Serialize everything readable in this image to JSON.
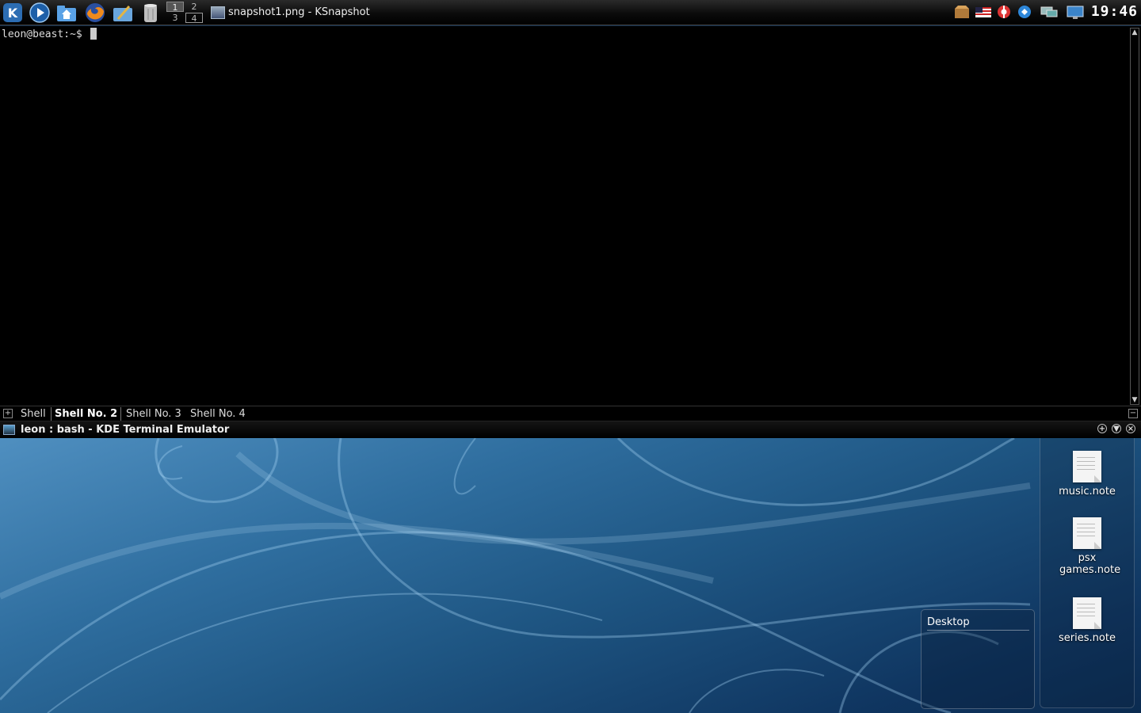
{
  "taskbar": {
    "launchers": [
      {
        "icon": "kde-menu-icon",
        "color": "#3b7bc2"
      },
      {
        "icon": "media-player-icon",
        "color": "#2d7fd0"
      },
      {
        "icon": "home-folder-icon",
        "color": "#4a90d9"
      },
      {
        "icon": "firefox-icon",
        "color": "#e86b1c"
      },
      {
        "icon": "text-editor-icon",
        "color": "#6aa0d6"
      },
      {
        "icon": "trash-icon",
        "color": "#999999"
      }
    ],
    "pager": [
      "1",
      "2",
      "3",
      "4"
    ],
    "task_title": "snapshot1.png - KSnapshot",
    "tray": [
      "package-icon",
      "keyboard-layout-flag-icon",
      "lifebuoy-icon",
      "network-icon",
      "monitor-icon",
      "desktop-icon"
    ],
    "clock": "19:46"
  },
  "terminal": {
    "prompt": "leon@beast:~$ ",
    "tabs": [
      "Shell",
      "Shell No. 2",
      "Shell No. 3",
      "Shell No. 4"
    ],
    "active_tab": "Shell No. 2",
    "window_title": "leon : bash - KDE Terminal Emulator"
  },
  "desktop": {
    "files": [
      {
        "name": "music.note"
      },
      {
        "name": "psx games.note"
      },
      {
        "name": "series.note"
      }
    ],
    "plasmoid_title": "Desktop"
  },
  "colors": {
    "terminal_bg": "#000000",
    "desktop_accent": "#2f6e9f"
  }
}
